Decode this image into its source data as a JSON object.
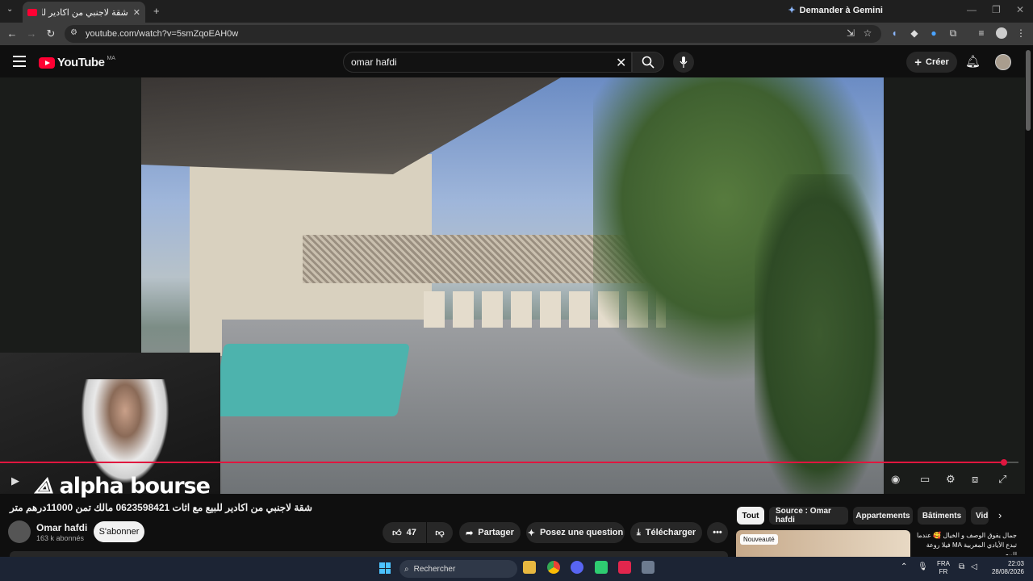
{
  "browser": {
    "tab_title": "شقة لاجنبي من اكادير للبيع مع اثا",
    "gemini_label": "Demander à Gemini",
    "url": "youtube.com/watch?v=5smZqoEAH0w"
  },
  "youtube": {
    "logo_text": "YouTube",
    "country_code": "MA",
    "search_value": "omar hafdi",
    "create_label": "Créer"
  },
  "player": {
    "watermark": "alpha bourse",
    "progress_fraction": 0.985
  },
  "video": {
    "title": "شقة لاجنبي من اكادير للبيع مع اثات 0623598421 مالك تمن 11000درهم متر",
    "channel_name": "Omar hafdi",
    "subscribers": "163 k abonnés",
    "subscribe_label": "S'abonner",
    "likes": "47",
    "share_label": "Partager",
    "ask_label": "Posez une question",
    "download_label": "Télécharger"
  },
  "chips": [
    "Tout",
    "Source : Omar hafdi",
    "Appartements",
    "Bâtiments",
    "Vid"
  ],
  "recommendation": {
    "badge": "Nouveauté",
    "title": "جمال يفوق الوصف و الخيال 🥰 عندما تبدع الأيادي المغربية MA فيلا روعة للبيع"
  },
  "taskbar": {
    "search_label": "Rechercher",
    "lang_top": "FRA",
    "lang_bottom": "FR",
    "time": "22:03",
    "date": "28/08/2026"
  },
  "colors": {
    "youtube_red": "#ff0033",
    "progress_red": "#e0163f",
    "taskbar": "#1c2434"
  }
}
